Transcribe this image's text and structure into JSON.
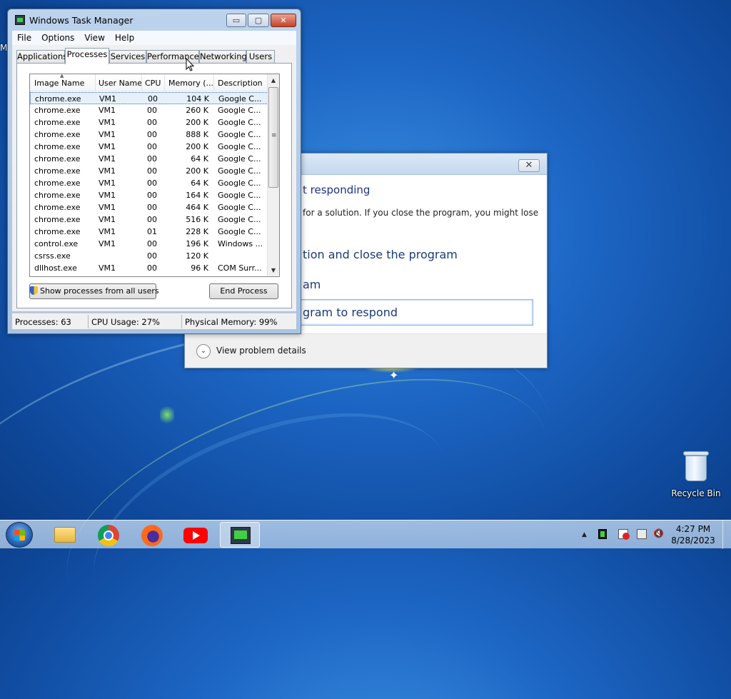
{
  "desktop": {
    "recycle_bin_label": "Recycle Bin",
    "edge_label": "M"
  },
  "dialog": {
    "heading": "t responding",
    "description": "for a solution. If you close the program, you might lose",
    "option_close": "tion and close the program",
    "option_restart": "am",
    "option_wait": "gram to respond",
    "details_label": "View problem details",
    "close_glyph": "✕"
  },
  "task_manager": {
    "title": "Windows Task Manager",
    "menu": [
      "File",
      "Options",
      "View",
      "Help"
    ],
    "tabs": [
      "Applications",
      "Processes",
      "Services",
      "Performance",
      "Networking",
      "Users"
    ],
    "active_tab": "Processes",
    "columns": [
      "Image Name",
      "User Name",
      "CPU",
      "Memory (...",
      "Description"
    ],
    "processes": [
      {
        "name": "chrome.exe",
        "user": "VM1",
        "cpu": "00",
        "mem": "104 K",
        "desc": "Google C..."
      },
      {
        "name": "chrome.exe",
        "user": "VM1",
        "cpu": "00",
        "mem": "260 K",
        "desc": "Google C..."
      },
      {
        "name": "chrome.exe",
        "user": "VM1",
        "cpu": "00",
        "mem": "200 K",
        "desc": "Google C..."
      },
      {
        "name": "chrome.exe",
        "user": "VM1",
        "cpu": "00",
        "mem": "888 K",
        "desc": "Google C..."
      },
      {
        "name": "chrome.exe",
        "user": "VM1",
        "cpu": "00",
        "mem": "200 K",
        "desc": "Google C..."
      },
      {
        "name": "chrome.exe",
        "user": "VM1",
        "cpu": "00",
        "mem": "64 K",
        "desc": "Google C..."
      },
      {
        "name": "chrome.exe",
        "user": "VM1",
        "cpu": "00",
        "mem": "200 K",
        "desc": "Google C..."
      },
      {
        "name": "chrome.exe",
        "user": "VM1",
        "cpu": "00",
        "mem": "64 K",
        "desc": "Google C..."
      },
      {
        "name": "chrome.exe",
        "user": "VM1",
        "cpu": "00",
        "mem": "164 K",
        "desc": "Google C..."
      },
      {
        "name": "chrome.exe",
        "user": "VM1",
        "cpu": "00",
        "mem": "464 K",
        "desc": "Google C..."
      },
      {
        "name": "chrome.exe",
        "user": "VM1",
        "cpu": "00",
        "mem": "516 K",
        "desc": "Google C..."
      },
      {
        "name": "chrome.exe",
        "user": "VM1",
        "cpu": "01",
        "mem": "228 K",
        "desc": "Google C..."
      },
      {
        "name": "control.exe",
        "user": "VM1",
        "cpu": "00",
        "mem": "196 K",
        "desc": "Windows ..."
      },
      {
        "name": "csrss.exe",
        "user": "",
        "cpu": "00",
        "mem": "120 K",
        "desc": ""
      },
      {
        "name": "dllhost.exe",
        "user": "VM1",
        "cpu": "00",
        "mem": "96 K",
        "desc": "COM Surr..."
      }
    ],
    "show_all_label": "Show processes from all users",
    "end_process_label": "End Process",
    "status": {
      "processes": "Processes: 63",
      "cpu": "CPU Usage: 27%",
      "memory": "Physical Memory: 99%"
    },
    "window_buttons": {
      "minimize": "▭",
      "maximize": "▢",
      "close": "✕"
    }
  },
  "taskbar": {
    "pinned": [
      "start-button",
      "file-explorer",
      "chrome",
      "firefox",
      "youtube",
      "task-manager"
    ],
    "active_item": "task-manager",
    "clock_time": "4:27 PM",
    "clock_date": "8/28/2023",
    "tray_icons": [
      "show-hidden-icons",
      "network-monitor-icon",
      "action-center-icon",
      "network-icon",
      "volume-muted-icon"
    ]
  }
}
